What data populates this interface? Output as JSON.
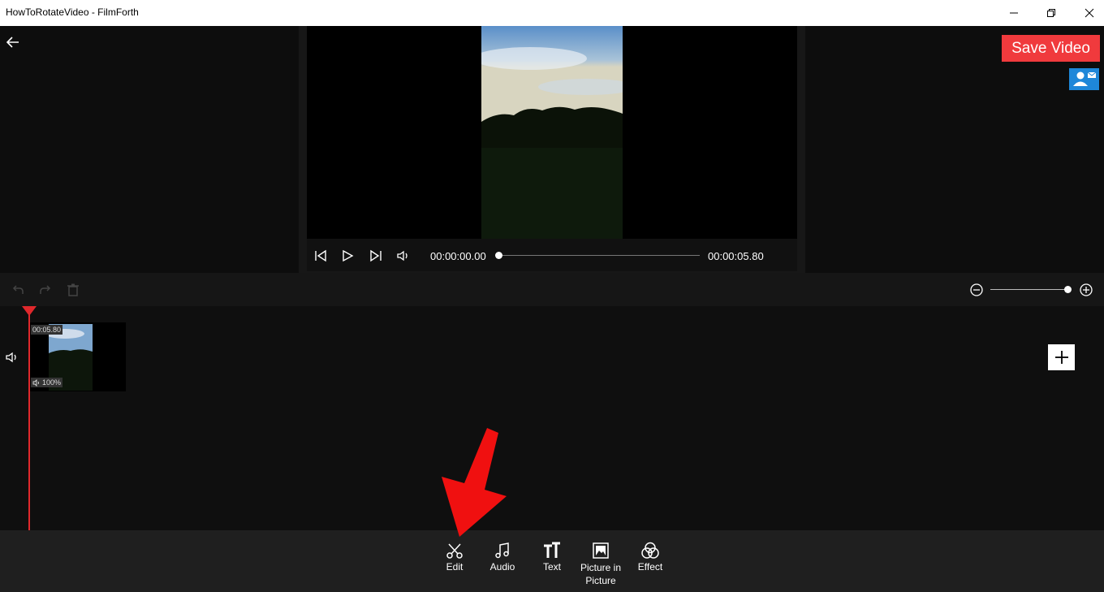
{
  "window": {
    "title": "HowToRotateVideo - FilmForth"
  },
  "header": {
    "save_label": "Save Video"
  },
  "player": {
    "current_time": "00:00:00.00",
    "total_time": "00:00:05.80",
    "progress": 0
  },
  "timeline": {
    "zoom_level": 1.0,
    "clip": {
      "duration": "00:05.80",
      "volume": "100%"
    }
  },
  "bottom_nav": [
    {
      "label": "Edit",
      "icon": "scissors-icon"
    },
    {
      "label": "Audio",
      "icon": "music-note-icon"
    },
    {
      "label": "Text",
      "icon": "text-icon"
    },
    {
      "label": "Picture in Picture",
      "icon": "picture-icon"
    },
    {
      "label": "Effect",
      "icon": "effect-icon"
    }
  ],
  "colors": {
    "accent_red": "#f03a3d",
    "contact_blue": "#1e87d9",
    "playhead": "#e0282c"
  }
}
